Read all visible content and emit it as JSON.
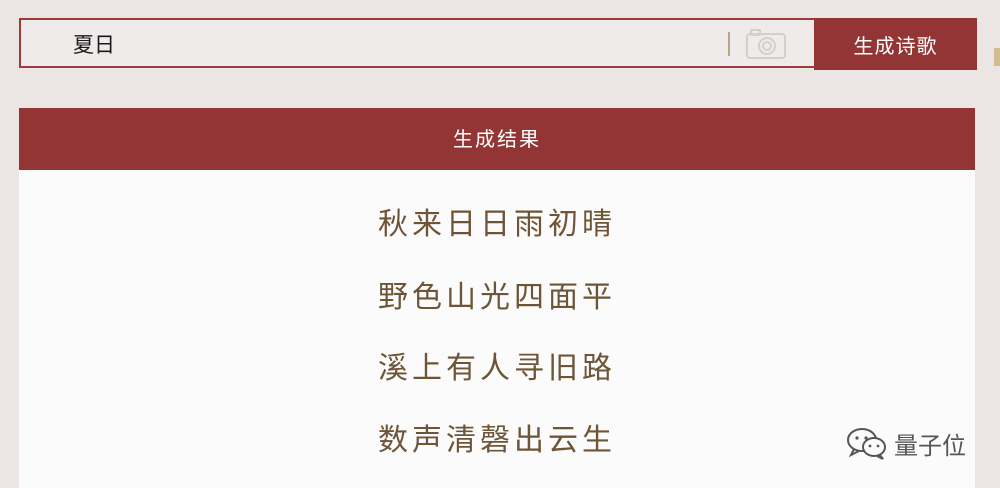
{
  "search": {
    "value": "夏日",
    "button_label": "生成诗歌",
    "camera_icon": "camera-icon"
  },
  "result": {
    "header": "生成结果",
    "poem_lines": [
      "秋来日日雨初晴",
      "野色山光四面平",
      "溪上有人寻旧路",
      "数声清磬出云生"
    ]
  },
  "watermark": {
    "text": "量子位",
    "icon": "wechat-icon"
  },
  "colors": {
    "accent": "#933535",
    "poem_text": "#6e5537",
    "background": "#ebe6e4"
  }
}
